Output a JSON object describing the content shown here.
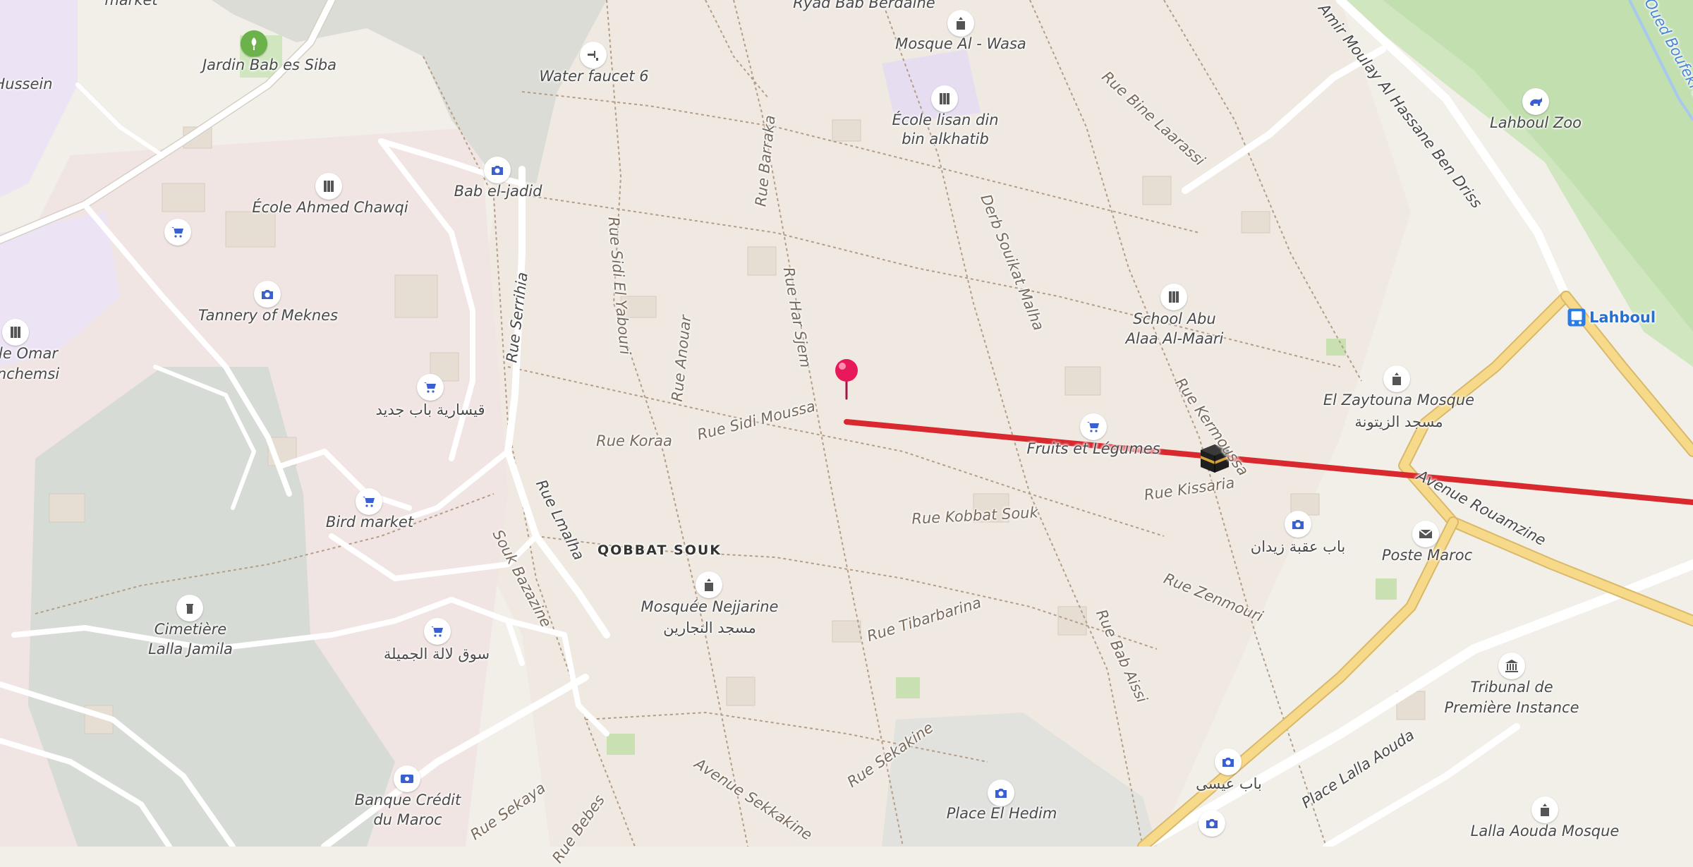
{
  "map": {
    "route_color": "#d9282e",
    "labels": {
      "market_top": "market",
      "hussein": "Hussein",
      "jardin_bab_es_siba": "Jardin Bab es Siba",
      "water_faucet": "Water faucet 6",
      "ryad_bab_berdaine": "Ryad Bab Berdaine",
      "mosque_al_wasa": "Mosque Al - Wasa",
      "ecole_lisan_l1": "École lisan din",
      "ecole_lisan_l2": "bin alkhatib",
      "rue_bine_laarassi": "Rue Bine Laarassi",
      "avenue_moulay": "Amir Moulay Al Hassane Ben Driss",
      "lahboul_zoo": "Lahboul Zoo",
      "oued_boufekrane": "Oued Boufekrane",
      "bab_el_jadid": "Bab el-jadid",
      "ecole_ahmed_chawqi": "École Ahmed Chawqi",
      "tannery": "Tannery of Meknes",
      "ecole_omar_l1": "le Omar",
      "ecole_omar_l2": "nchemsi",
      "rue_serrihia": "Rue Serrihia",
      "rue_sidi_el_yabouri": "Rue Sidi El Yabouri",
      "rue_anouar": "Rue Anouar",
      "rue_barraka": "Rue Barraka",
      "rue_har_sjem": "Rue Har Sjem",
      "derb_souikat": "Derb Souikat Malha",
      "school_abu_l1": "School Abu",
      "school_abu_l2": "Alaa Al-Maari",
      "lahboul": "Lahboul",
      "qaysariya": "قيسارية باب جديد",
      "rue_koraa": "Rue Koraa",
      "rue_sidi_moussa": "Rue Sidi Moussa",
      "fruits_legumes": "Fruits et Légumes",
      "rue_kermoussa": "Rue Kermoussa",
      "el_zaytouna_l1": "El Zaytouna Mosque",
      "el_zaytouna_l2": "مسجد الزيتونة",
      "rue_kissaria": "Rue Kissaria",
      "avenue_rouamzine": "Avenue Rouamzine",
      "bird_market": "Bird market",
      "rue_lmalha": "Rue Lmalha",
      "qobbat_souk": "QOBBAT SOUK",
      "rue_kobbat_souk": "Rue Kobbat Souk",
      "bab_aqba_zidane": "باب عقبة زيدان",
      "poste_maroc": "Poste Maroc",
      "souk_bazazine": "Souk Bazazine",
      "mosquee_nejjarine_l1": "Mosquée Nejjarine",
      "mosquee_nejjarine_l2": "مسجد النجارين",
      "rue_zenmouri": "Rue Zenmouri",
      "cimetiere_l1": "Cimetière",
      "cimetiere_l2": "Lalla Jamila",
      "souq_lalla": "سوق لالة الجميلة",
      "rue_tibarbarina": "Rue Tibarbarina",
      "rue_bab_aissi": "Rue Bab Aissi",
      "tribunal_l1": "Tribunal de",
      "tribunal_l2": "Première Instance",
      "avenue_sekkakine": "Avenue Sekkakine",
      "rue_sekakine": "Rue Sekakine",
      "bab_aissi_ar": "باب عيسى",
      "place_lalla_aouda": "Place Lalla Aouda",
      "banque_l1": "Banque Crédit",
      "banque_l2": "du Maroc",
      "rue_sekaya": "Rue Sekaya",
      "rue_bebes": "Rue Bebes",
      "place_el_hedim": "Place El Hedim",
      "lalla_aouda_mosque": "Lalla Aouda Mosque"
    }
  }
}
